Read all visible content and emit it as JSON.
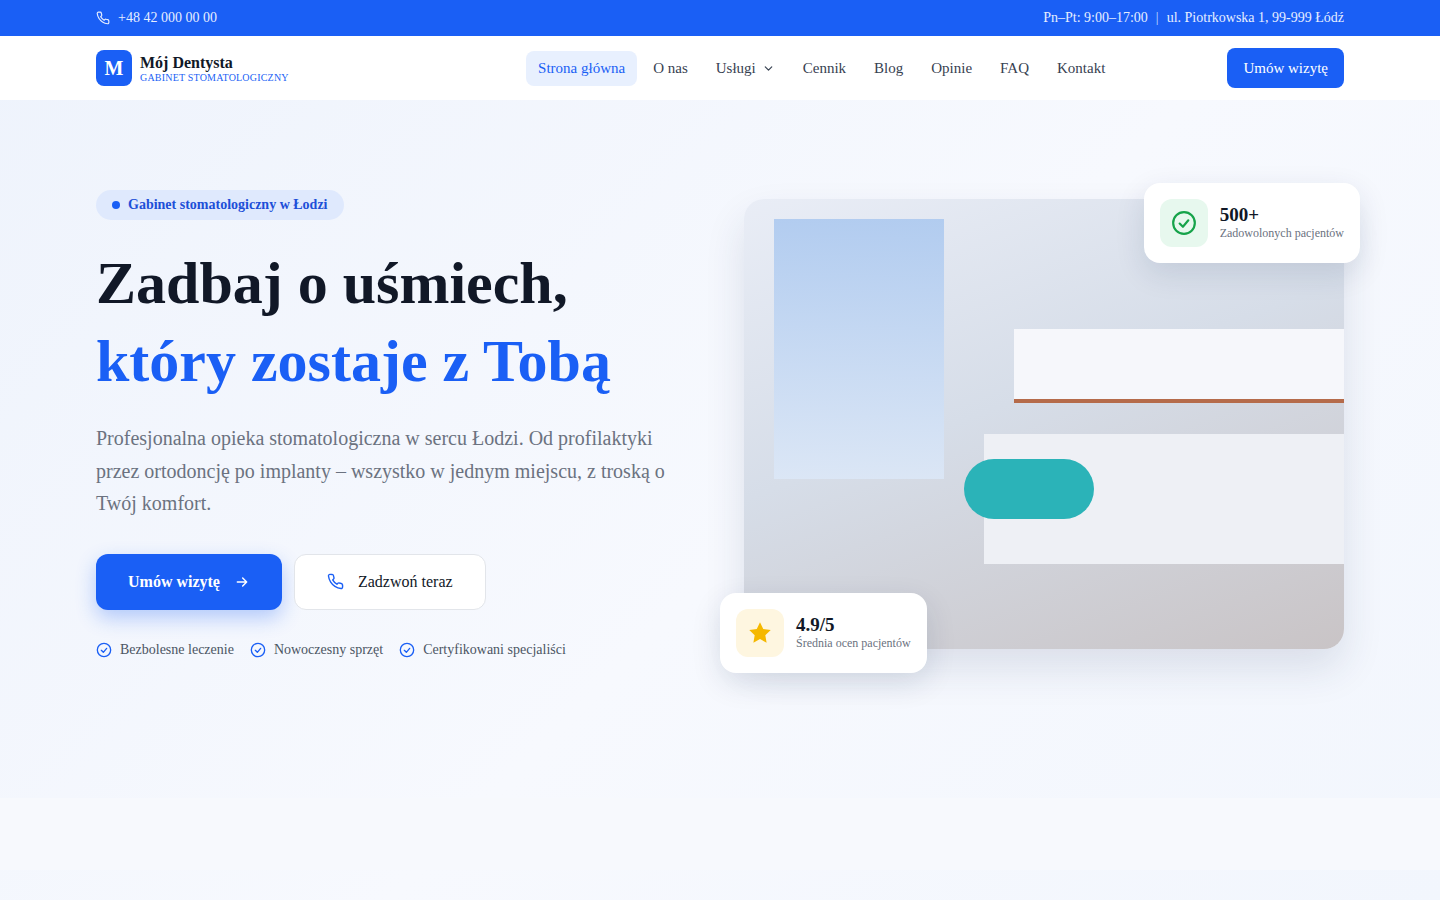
{
  "topbar": {
    "phone": "+48 42 000 00 00",
    "hours": "Pn–Pt: 9:00–17:00",
    "separator": "|",
    "address": "ul. Piotrkowska 1, 99-999 Łódź"
  },
  "logo": {
    "letter": "M",
    "name": "Mój Dentysta",
    "subtitle": "GABINET STOMATOLOGICZNY"
  },
  "nav": [
    {
      "label": "Strona główna",
      "selected": true,
      "has_menu": false
    },
    {
      "label": "O nas",
      "selected": false,
      "has_menu": false
    },
    {
      "label": "Usługi",
      "selected": false,
      "has_menu": true
    },
    {
      "label": "Cennik",
      "selected": false,
      "has_menu": false
    },
    {
      "label": "Blog",
      "selected": false,
      "has_menu": false
    },
    {
      "label": "Opinie",
      "selected": false,
      "has_menu": false
    },
    {
      "label": "FAQ",
      "selected": false,
      "has_menu": false
    },
    {
      "label": "Kontakt",
      "selected": false,
      "has_menu": false
    }
  ],
  "header_cta": "Umów wizytę",
  "hero": {
    "badge": "Gabinet stomatologiczny w Łodzi",
    "title_line1": "Zadbaj o uśmiech,",
    "title_line2": "który zostaje z Tobą",
    "description": "Profesjonalna opieka stomatologiczna w sercu Łodzi. Od profilaktyki przez ortodoncję po implanty – wszystko w jednym miejscu, z troską o Twój komfort.",
    "primary_button": "Umów wizytę",
    "secondary_button": "Zadzwoń teraz",
    "features": [
      "Bezbolesne leczenie",
      "Nowoczesny sprzęt",
      "Certyfikowani specjaliści"
    ]
  },
  "stats": {
    "patients": {
      "value": "500+",
      "label": "Zadowolonych pacjentów"
    },
    "rating": {
      "value": "4.9/5",
      "label": "Średnia ocen pacjentów"
    }
  }
}
